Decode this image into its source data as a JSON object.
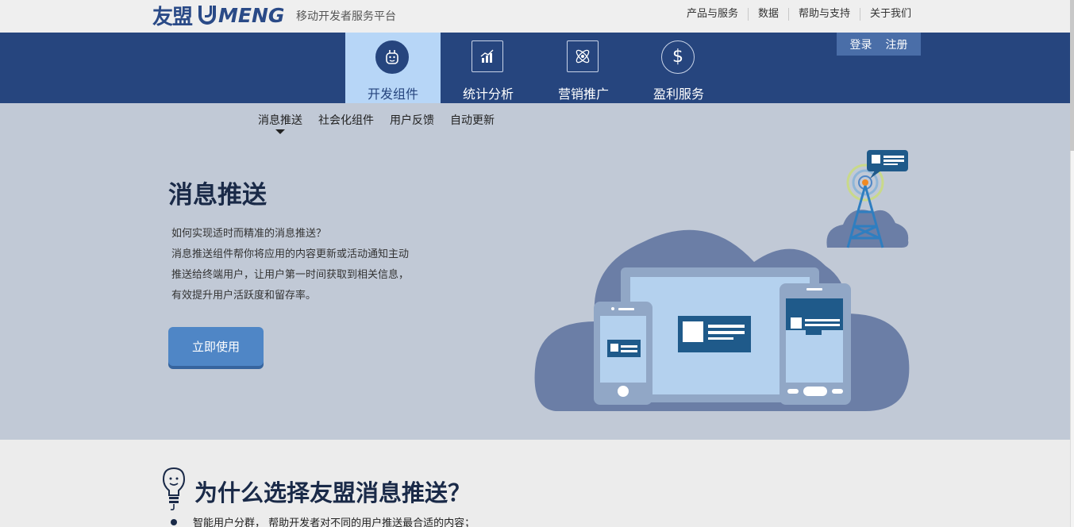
{
  "header": {
    "logo_cn": "友盟",
    "logo_en": "MENG",
    "slogan": "移动开发者服务平台",
    "links": [
      "产品与服务",
      "数据",
      "帮助与支持",
      "关于我们"
    ]
  },
  "nav": {
    "items": [
      {
        "label": "开发组件",
        "icon": "robot-icon",
        "active": true
      },
      {
        "label": "统计分析",
        "icon": "chart-icon",
        "active": false
      },
      {
        "label": "营销推广",
        "icon": "atom-icon",
        "active": false
      },
      {
        "label": "盈利服务",
        "icon": "dollar-icon",
        "active": false
      }
    ],
    "login": "登录",
    "register": "注册"
  },
  "subnav": [
    "消息推送",
    "社会化组件",
    "用户反馈",
    "自动更新"
  ],
  "hero": {
    "title": "消息推送",
    "desc": [
      "如何实现适时而精准的消息推送？",
      "消息推送组件帮你将应用的内容更新或活动通知主动",
      "推送给终端用户，让用户第一时间获取到相关信息，",
      "有效提升用户活跃度和留存率。"
    ],
    "cta": "立即使用"
  },
  "why": {
    "title": "为什么选择友盟消息推送？",
    "items": [
      "智能用户分群， 帮助开发者对不同的用户推送最合适的内容；"
    ]
  },
  "colors": {
    "nav_bg": "#26457e",
    "nav_active": "#b7d6f7",
    "hero_bg": "#c1c9d6",
    "cta": "#4f86c6",
    "cloud": "#6b7ea6"
  }
}
